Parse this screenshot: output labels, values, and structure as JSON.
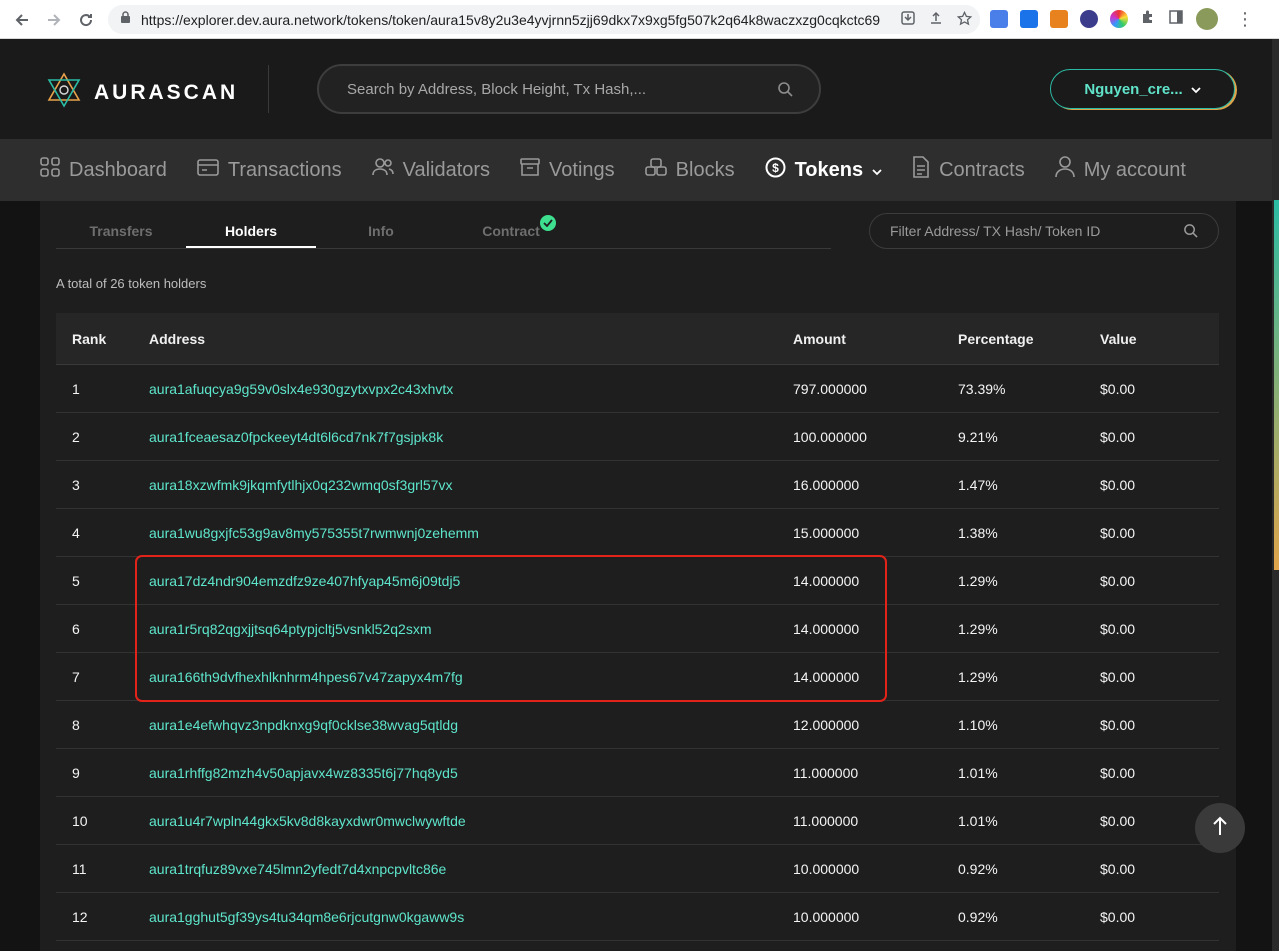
{
  "browser": {
    "url": "https://explorer.dev.aura.network/tokens/token/aura15v8y2u3e4yvjrnn5zjj69dkx7x9xg5fg507k2q64k8waczxzg0cqkctc69"
  },
  "header": {
    "logo_text": "AURASCAN",
    "search_placeholder": "Search by Address, Block Height, Tx Hash,...",
    "account_label": "Nguyen_cre..."
  },
  "nav": {
    "items": [
      {
        "label": "Dashboard",
        "icon": "grid-icon"
      },
      {
        "label": "Transactions",
        "icon": "wallet-icon"
      },
      {
        "label": "Validators",
        "icon": "users-icon"
      },
      {
        "label": "Votings",
        "icon": "archive-icon"
      },
      {
        "label": "Blocks",
        "icon": "blocks-icon"
      },
      {
        "label": "Tokens",
        "icon": "dollar-coin-icon"
      },
      {
        "label": "Contracts",
        "icon": "document-icon"
      },
      {
        "label": "My account",
        "icon": "user-icon"
      }
    ],
    "active": "Tokens"
  },
  "tabs": {
    "transfers": "Transfers",
    "holders": "Holders",
    "info": "Info",
    "contract": "Contract"
  },
  "filter": {
    "placeholder": "Filter Address/ TX Hash/ Token ID"
  },
  "summary": "A total of 26 token holders",
  "table": {
    "headers": {
      "rank": "Rank",
      "address": "Address",
      "amount": "Amount",
      "percentage": "Percentage",
      "value": "Value"
    },
    "rows": [
      {
        "rank": "1",
        "address": "aura1afuqcya9g59v0slx4e930gzytxvpx2c43xhvtx",
        "amount": "797.000000",
        "percentage": "73.39%",
        "value": "$0.00"
      },
      {
        "rank": "2",
        "address": "aura1fceaesaz0fpckeeyt4dt6l6cd7nk7f7gsjpk8k",
        "amount": "100.000000",
        "percentage": "9.21%",
        "value": "$0.00"
      },
      {
        "rank": "3",
        "address": "aura18xzwfmk9jkqmfytlhjx0q232wmq0sf3grl57vx",
        "amount": "16.000000",
        "percentage": "1.47%",
        "value": "$0.00"
      },
      {
        "rank": "4",
        "address": "aura1wu8gxjfc53g9av8my575355t7rwmwnj0zehemm",
        "amount": "15.000000",
        "percentage": "1.38%",
        "value": "$0.00"
      },
      {
        "rank": "5",
        "address": "aura17dz4ndr904emzdfz9ze407hfyap45m6j09tdj5",
        "amount": "14.000000",
        "percentage": "1.29%",
        "value": "$0.00"
      },
      {
        "rank": "6",
        "address": "aura1r5rq82qgxjjtsq64ptypjcltj5vsnkl52q2sxm",
        "amount": "14.000000",
        "percentage": "1.29%",
        "value": "$0.00"
      },
      {
        "rank": "7",
        "address": "aura166th9dvfhexhlknhrm4hpes67v47zapyx4m7fg",
        "amount": "14.000000",
        "percentage": "1.29%",
        "value": "$0.00"
      },
      {
        "rank": "8",
        "address": "aura1e4efwhqvz3npdknxg9qf0cklse38wvag5qtldg",
        "amount": "12.000000",
        "percentage": "1.10%",
        "value": "$0.00"
      },
      {
        "rank": "9",
        "address": "aura1rhffg82mzh4v50apjavx4wz8335t6j77hq8yd5",
        "amount": "11.000000",
        "percentage": "1.01%",
        "value": "$0.00"
      },
      {
        "rank": "10",
        "address": "aura1u4r7wpln44gkx5kv8d8kayxdwr0mwclwywftde",
        "amount": "11.000000",
        "percentage": "1.01%",
        "value": "$0.00"
      },
      {
        "rank": "11",
        "address": "aura1trqfuz89vxe745lmn2yfedt7d4xnpcpvltc86e",
        "amount": "10.000000",
        "percentage": "0.92%",
        "value": "$0.00"
      },
      {
        "rank": "12",
        "address": "aura1gghut5gf39ys4tu34qm8e6rjcutgnw0kgaww9s",
        "amount": "10.000000",
        "percentage": "0.92%",
        "value": "$0.00"
      }
    ]
  },
  "colors": {
    "accent": "#5ee6cc",
    "highlight": "#e2231a",
    "check": "#3ee08f"
  }
}
